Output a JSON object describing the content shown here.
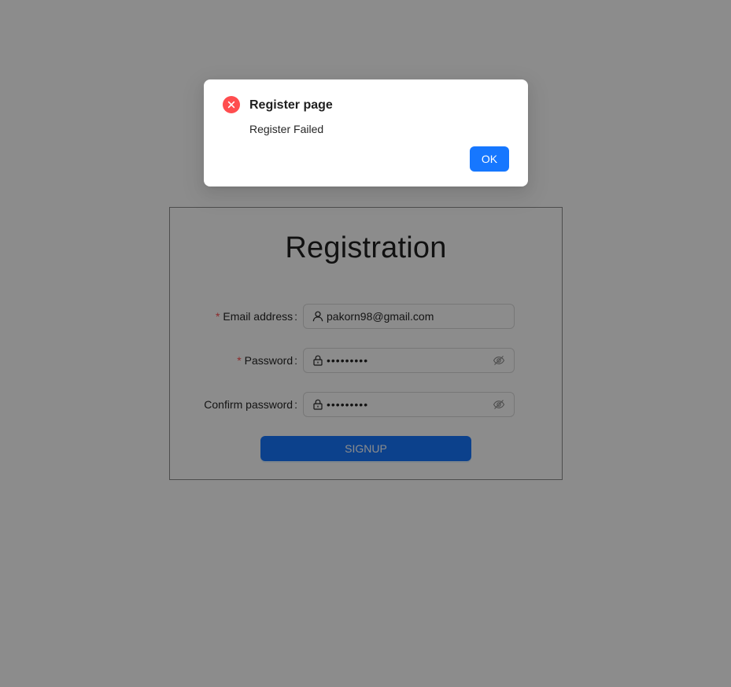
{
  "registration": {
    "title": "Registration",
    "fields": {
      "email": {
        "label": "Email address",
        "required": true,
        "value": "pakorn98@gmail.com"
      },
      "password": {
        "label": "Password",
        "required": true,
        "value": "•••••••••"
      },
      "confirm": {
        "label": "Confirm password",
        "required": false,
        "value": "•••••••••"
      }
    },
    "required_mark": "*",
    "colon": ":",
    "signup_label": "SIGNUP"
  },
  "modal": {
    "title": "Register page",
    "message": "Register Failed",
    "ok_label": "OK",
    "status": "error"
  },
  "icons": {
    "error": "close-circle-icon",
    "user": "user-icon",
    "lock": "lock-icon",
    "eye": "eye-invisible-icon"
  },
  "colors": {
    "primary": "#1677ff",
    "error": "#ff4d4f",
    "mask": "rgba(0,0,0,0.45)"
  }
}
